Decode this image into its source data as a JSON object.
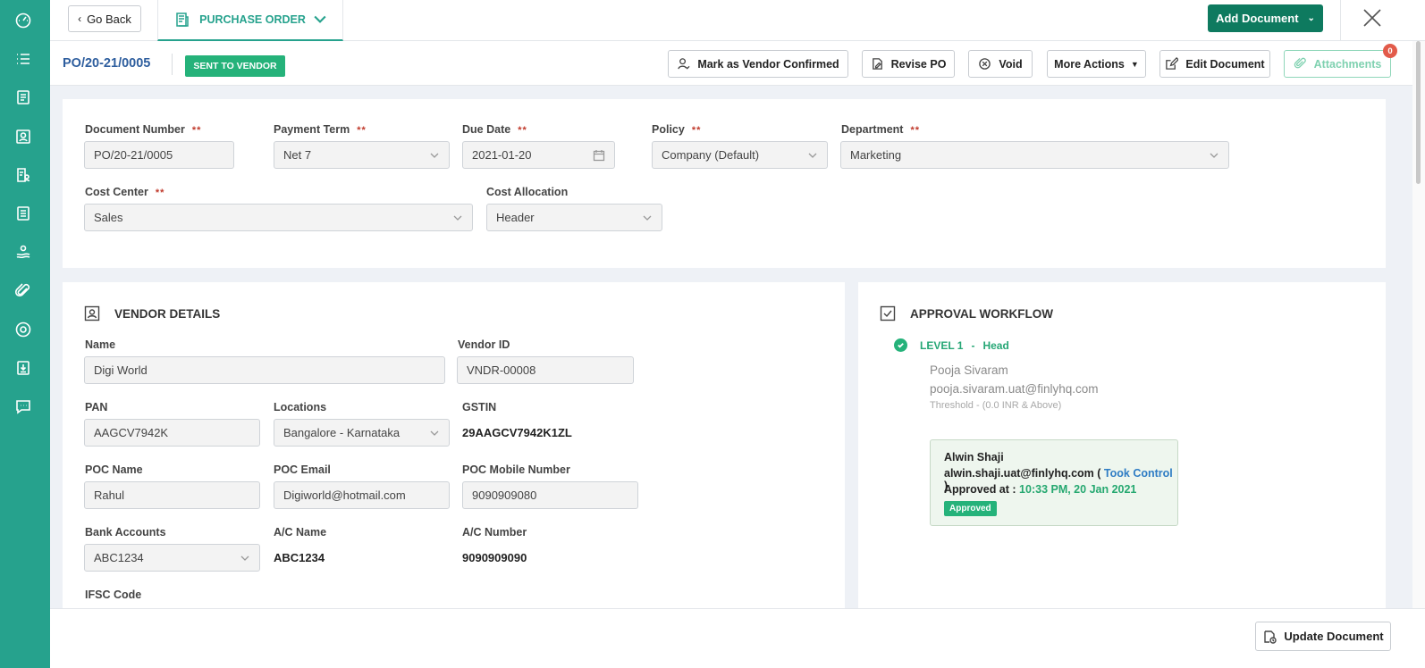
{
  "sidebar": {
    "items": [
      {
        "icon": "dashboard-icon"
      },
      {
        "icon": "list-icon"
      },
      {
        "icon": "document-icon"
      },
      {
        "icon": "contact-card-icon"
      },
      {
        "icon": "user-report-icon"
      },
      {
        "icon": "invoice-icon"
      },
      {
        "icon": "payments-icon"
      },
      {
        "icon": "attachment-icon"
      },
      {
        "icon": "circle-icon"
      },
      {
        "icon": "download-report-icon"
      },
      {
        "icon": "chat-icon"
      }
    ]
  },
  "topbar": {
    "go_back": "Go Back",
    "tab_label": "PURCHASE ORDER",
    "add_document": "Add Document"
  },
  "actionbar": {
    "po_number": "PO/20-21/0005",
    "status": "SENT TO VENDOR",
    "buttons": {
      "mark_confirmed": "Mark as Vendor Confirmed",
      "revise": "Revise PO",
      "void": "Void",
      "more_actions": "More Actions",
      "edit": "Edit Document",
      "attachments": "Attachments",
      "attachments_count": "0"
    }
  },
  "header_form": {
    "document_number": {
      "label": "Document Number",
      "value": "PO/20-21/0005",
      "required": "**"
    },
    "payment_term": {
      "label": "Payment Term",
      "value": "Net 7",
      "required": "**"
    },
    "due_date": {
      "label": "Due Date",
      "value": "2021-01-20",
      "required": "**"
    },
    "policy": {
      "label": "Policy",
      "value": "Company (Default)",
      "required": "**"
    },
    "department": {
      "label": "Department",
      "value": "Marketing",
      "required": "**"
    },
    "cost_center": {
      "label": "Cost Center",
      "value": "Sales",
      "required": "**"
    },
    "cost_allocation": {
      "label": "Cost Allocation",
      "value": "Header"
    }
  },
  "vendor": {
    "title": "VENDOR DETAILS",
    "name": {
      "label": "Name",
      "value": "Digi World"
    },
    "vendor_id": {
      "label": "Vendor ID",
      "value": "VNDR-00008"
    },
    "pan": {
      "label": "PAN",
      "value": "AAGCV7942K"
    },
    "locations": {
      "label": "Locations",
      "value": "Bangalore - Karnataka"
    },
    "gstin": {
      "label": "GSTIN",
      "value": "29AAGCV7942K1ZL"
    },
    "poc_name": {
      "label": "POC Name",
      "value": "Rahul"
    },
    "poc_email": {
      "label": "POC Email",
      "value": "Digiworld@hotmail.com"
    },
    "poc_mobile": {
      "label": "POC Mobile Number",
      "value": "9090909080"
    },
    "bank_accounts": {
      "label": "Bank Accounts",
      "value": "ABC1234"
    },
    "ac_name": {
      "label": "A/C Name",
      "value": "ABC1234"
    },
    "ac_number": {
      "label": "A/C Number",
      "value": "9090909090"
    },
    "ifsc": {
      "label": "IFSC Code"
    }
  },
  "approval": {
    "title": "APPROVAL WORKFLOW",
    "level": "LEVEL 1",
    "level_sep": "-",
    "level_role": "Head",
    "approver_name": "Pooja Sivaram",
    "approver_email": "pooja.sivaram.uat@finlyhq.com",
    "threshold": "Threshold -  (0.0 INR  & Above)",
    "box": {
      "name": "Alwin Shaji",
      "email": "alwin.shaji.uat@finlyhq.com",
      "paren_open": "(",
      "took_control": "Took Control",
      "paren_close": ")",
      "approved_at_label": "Approved at :",
      "approved_at": "10:33 PM, 20 Jan 2021",
      "badge": "Approved"
    }
  },
  "footer": {
    "update_document": "Update Document"
  },
  "colors": {
    "sidebar": "#26a28d",
    "primary": "#0e7a5f",
    "status_green": "#25b27a",
    "link_blue": "#2e5e9e"
  }
}
